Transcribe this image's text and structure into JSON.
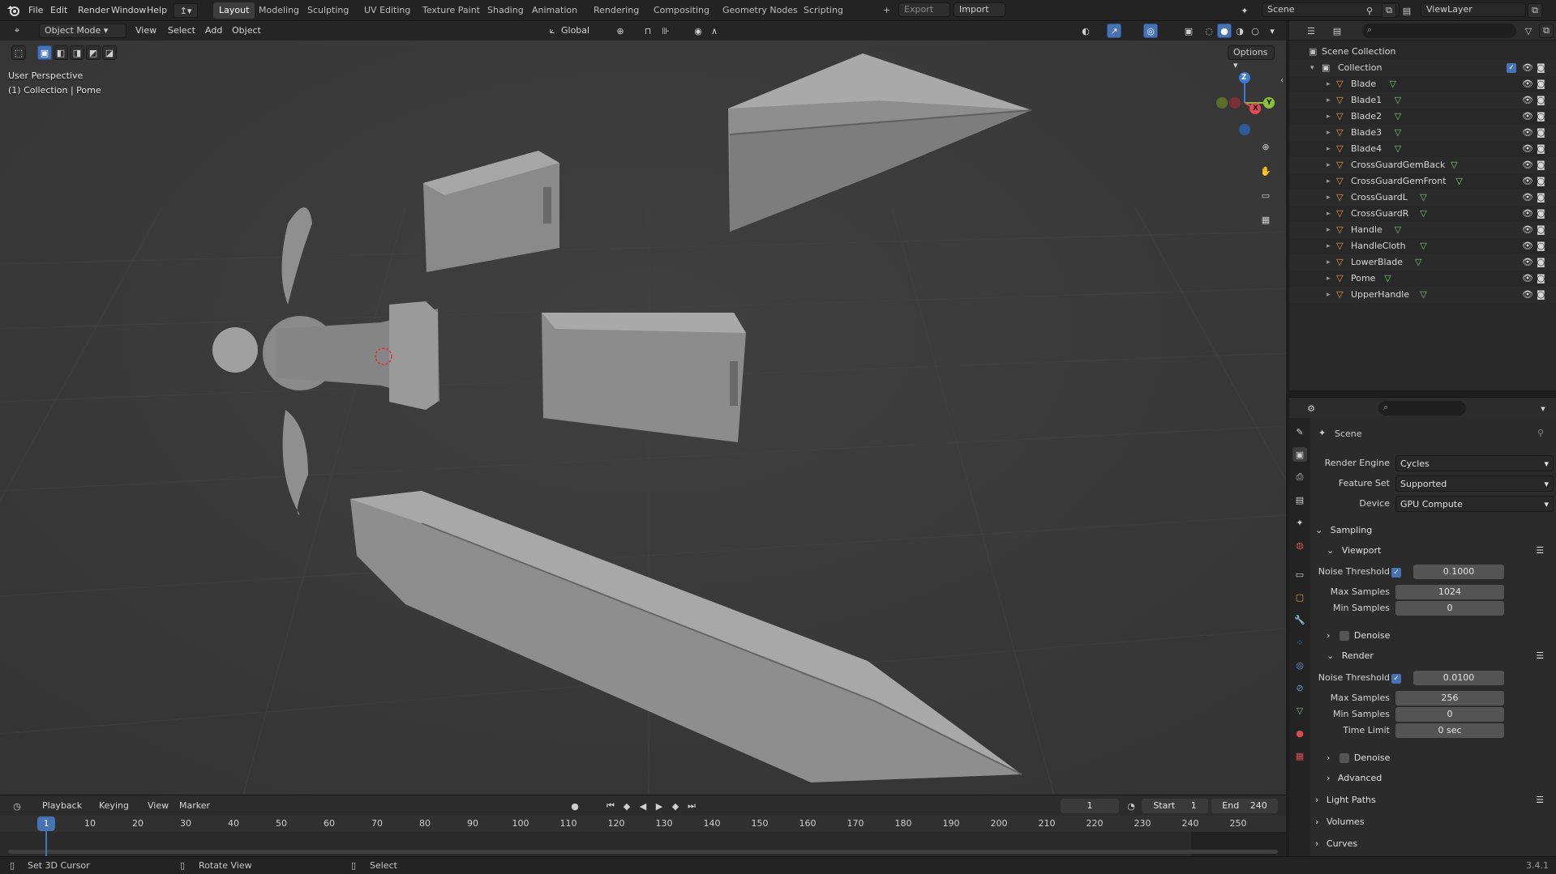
{
  "top_menu": {
    "items": [
      "File",
      "Edit",
      "Render",
      "Window",
      "Help"
    ]
  },
  "workspaces": {
    "tabs": [
      "Layout",
      "Modeling",
      "Sculpting",
      "UV Editing",
      "Texture Paint",
      "Shading",
      "Animation",
      "Rendering",
      "Compositing",
      "Geometry Nodes",
      "Scripting"
    ],
    "active": "Layout",
    "add_symbol": "+"
  },
  "file_actions": {
    "export": "Export",
    "import": "Import"
  },
  "scene_selector": {
    "scene": "Scene",
    "view_layer": "ViewLayer"
  },
  "viewport_header": {
    "mode": "Object Mode",
    "menus": [
      "View",
      "Select",
      "Add",
      "Object"
    ],
    "transform_orientation": "Global",
    "options": "Options"
  },
  "viewport_overlay": {
    "perspective": "User Perspective",
    "collection_info": "(1) Collection | Pome"
  },
  "gizmo_axes": {
    "z": "Z",
    "y": "Y",
    "x": "X"
  },
  "outliner": {
    "root": "Scene Collection",
    "collection": "Collection",
    "objects": [
      "Blade",
      "Blade1",
      "Blade2",
      "Blade3",
      "Blade4",
      "CrossGuardGemBack",
      "CrossGuardGemFront",
      "CrossGuardL",
      "CrossGuardR",
      "Handle",
      "HandleCloth",
      "LowerBlade",
      "Pome",
      "UpperHandle"
    ]
  },
  "properties": {
    "context": "Scene",
    "render_engine": {
      "label": "Render Engine",
      "value": "Cycles"
    },
    "feature_set": {
      "label": "Feature Set",
      "value": "Supported"
    },
    "device": {
      "label": "Device",
      "value": "GPU Compute"
    },
    "sampling": {
      "title": "Sampling",
      "viewport": {
        "title": "Viewport",
        "noise_threshold_label": "Noise Threshold",
        "noise_threshold": "0.1000",
        "max_samples_label": "Max Samples",
        "max_samples": "1024",
        "min_samples_label": "Min Samples",
        "min_samples": "0",
        "denoise": "Denoise"
      },
      "render": {
        "title": "Render",
        "noise_threshold_label": "Noise Threshold",
        "noise_threshold": "0.0100",
        "max_samples_label": "Max Samples",
        "max_samples": "256",
        "min_samples_label": "Min Samples",
        "min_samples": "0",
        "time_limit_label": "Time Limit",
        "time_limit": "0 sec",
        "denoise": "Denoise"
      },
      "advanced": "Advanced"
    },
    "light_paths": "Light Paths",
    "volumes": "Volumes",
    "curves": "Curves"
  },
  "timeline": {
    "menus": [
      "Playback",
      "Keying",
      "View",
      "Marker"
    ],
    "current_frame": "1",
    "start_label": "Start",
    "start": "1",
    "end_label": "End",
    "end": "240",
    "frame_ticks": [
      "1",
      "10",
      "20",
      "30",
      "40",
      "50",
      "60",
      "70",
      "80",
      "90",
      "100",
      "110",
      "120",
      "130",
      "140",
      "150",
      "160",
      "170",
      "180",
      "190",
      "200",
      "210",
      "220",
      "230",
      "240",
      "250"
    ]
  },
  "statusbar": {
    "left": "Set 3D Cursor",
    "middle": "Rotate View",
    "right": "Select",
    "version": "3.4.1"
  },
  "colors": {
    "accent": "#4772b3",
    "viewport_bg": "#3a3a3a",
    "panel_bg": "#2b2b2b",
    "mesh_orange": "#e89a3c",
    "mesh_green": "#7ec87a"
  }
}
